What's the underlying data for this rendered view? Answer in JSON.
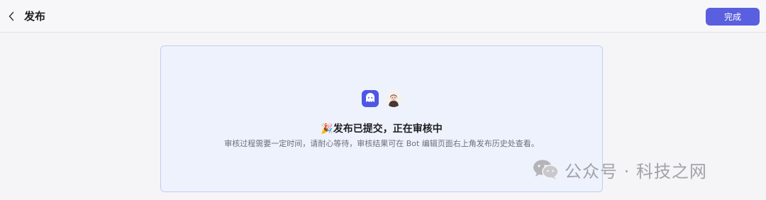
{
  "header": {
    "title": "发布",
    "done_label": "完成"
  },
  "card": {
    "emoji": "🎉",
    "heading": "发布已提交，正在审核中",
    "subtext": "审核过程需要一定时间，请耐心等待，审核结果可在 Bot 编辑页面右上角发布历史处查看。"
  },
  "watermark": {
    "text": "公众号 · 科技之网"
  },
  "colors": {
    "accent": "#5a5fe0",
    "card_bg": "#eef2fd",
    "card_border": "#c3ccf1"
  },
  "icons": {
    "back": "chevron-left-icon",
    "bot": "bot-avatar-icon",
    "user": "user-avatar-icon",
    "watermark": "wechat-icon"
  }
}
